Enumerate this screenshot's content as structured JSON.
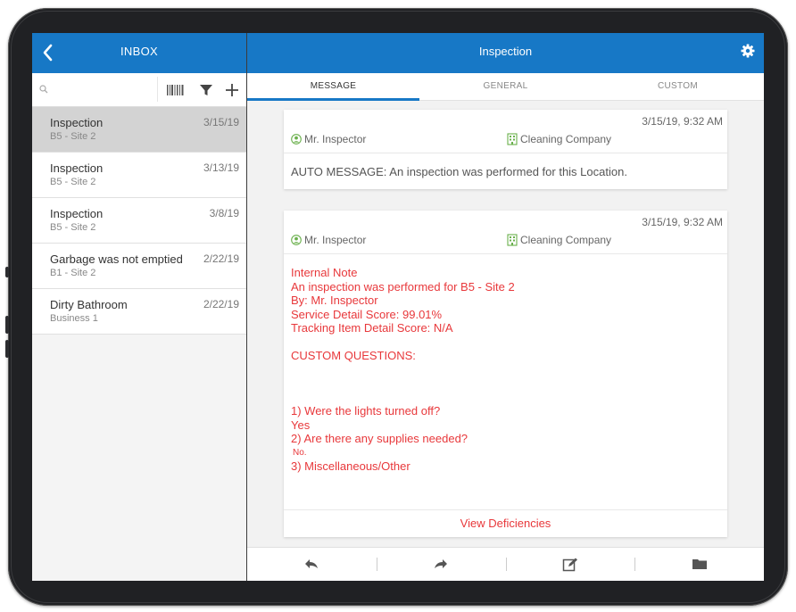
{
  "inbox": {
    "title": "INBOX",
    "search_placeholder": "",
    "items": [
      {
        "title": "Inspection",
        "subtitle": "B5 - Site 2",
        "date": "3/15/19",
        "selected": true
      },
      {
        "title": "Inspection",
        "subtitle": "B5 - Site 2",
        "date": "3/13/19",
        "selected": false
      },
      {
        "title": "Inspection",
        "subtitle": "B5 - Site 2",
        "date": "3/8/19",
        "selected": false
      },
      {
        "title": "Garbage was not emptied",
        "subtitle": "B1 - Site 2",
        "date": "2/22/19",
        "selected": false
      },
      {
        "title": "Dirty Bathroom",
        "subtitle": "Business 1",
        "date": "2/22/19",
        "selected": false
      }
    ]
  },
  "detail": {
    "title": "Inspection",
    "tabs": [
      {
        "label": "MESSAGE",
        "active": true
      },
      {
        "label": "GENERAL",
        "active": false
      },
      {
        "label": "CUSTOM",
        "active": false
      }
    ],
    "messages": [
      {
        "timestamp": "3/15/19, 9:32 AM",
        "sender": "Mr. Inspector",
        "organization": "Cleaning Company",
        "body": "AUTO MESSAGE: An inspection was performed for this Location."
      },
      {
        "timestamp": "3/15/19, 9:32 AM",
        "sender": "Mr. Inspector",
        "organization": "Cleaning Company",
        "lines": [
          "Internal Note",
          "An inspection was performed for B5 - Site 2",
          "By: Mr. Inspector",
          "Service Detail Score: 99.01%",
          "Tracking Item Detail Score: N/A",
          "",
          "CUSTOM QUESTIONS:",
          "",
          "",
          "1) Were the lights turned off?",
          "Yes",
          "2) Are there any supplies needed?",
          "No.",
          "3) Miscellaneous/Other"
        ],
        "footer_link": "View Deficiencies"
      }
    ]
  },
  "colors": {
    "header_blue": "#1778c6",
    "note_red": "#e8383b",
    "person_green": "#6ab04c"
  },
  "icons": {
    "back": "chevron-left-icon",
    "barcode": "barcode-icon",
    "filter": "filter-icon",
    "add": "plus-icon",
    "settings": "gear-icon",
    "reply": "reply-icon",
    "forward": "forward-icon",
    "edit": "edit-icon",
    "folder": "folder-icon"
  }
}
